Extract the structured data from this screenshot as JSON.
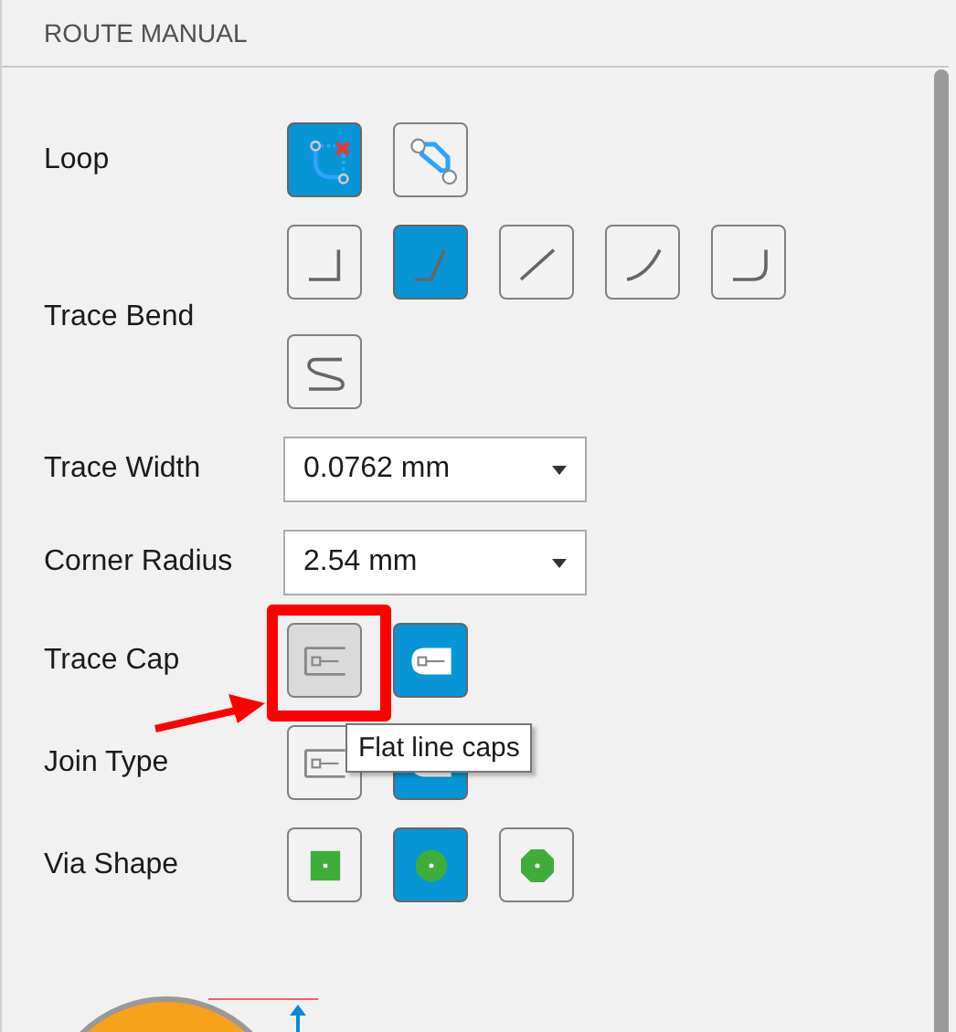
{
  "panel": {
    "title": "ROUTE MANUAL"
  },
  "rows": [
    {
      "label": "Loop",
      "kind": "buttons",
      "buttons": [
        {
          "kind": "loop-open",
          "selected": true,
          "hovered": false
        },
        {
          "kind": "loop-closed",
          "selected": false,
          "hovered": false
        }
      ]
    },
    {
      "label": "Trace Bend",
      "kind": "buttons",
      "buttons": [
        {
          "kind": "bend-square",
          "selected": false,
          "hovered": false
        },
        {
          "kind": "bend-steep",
          "selected": true,
          "hovered": false
        },
        {
          "kind": "bend-diagonal",
          "selected": false,
          "hovered": false
        },
        {
          "kind": "bend-arc",
          "selected": false,
          "hovered": false
        },
        {
          "kind": "bend-rounded",
          "selected": false,
          "hovered": false
        },
        {
          "kind": "bend-s",
          "selected": false,
          "hovered": false
        }
      ]
    },
    {
      "label": "Trace Width",
      "kind": "dropdown",
      "value": "0.0762 mm"
    },
    {
      "label": "Corner Radius",
      "kind": "dropdown",
      "value": "2.54 mm"
    },
    {
      "label": "Trace Cap",
      "kind": "buttons",
      "buttons": [
        {
          "kind": "cap-flat",
          "selected": false,
          "hovered": true
        },
        {
          "kind": "cap-round",
          "selected": true,
          "hovered": false
        }
      ]
    },
    {
      "label": "Join Type",
      "kind": "buttons",
      "buttons": [
        {
          "kind": "cap-flat",
          "selected": false,
          "hovered": false
        },
        {
          "kind": "cap-round",
          "selected": true,
          "hovered": false
        }
      ]
    },
    {
      "label": "Via Shape",
      "kind": "buttons",
      "buttons": [
        {
          "kind": "via-square",
          "selected": false,
          "hovered": false
        },
        {
          "kind": "via-circle",
          "selected": true,
          "hovered": false
        },
        {
          "kind": "via-octagon",
          "selected": false,
          "hovered": false
        }
      ]
    }
  ],
  "tooltip": {
    "text": "Flat line caps"
  },
  "annotation": {
    "kind": "highlight-with-arrow"
  },
  "preview": {
    "kind": "corner-diagram"
  }
}
